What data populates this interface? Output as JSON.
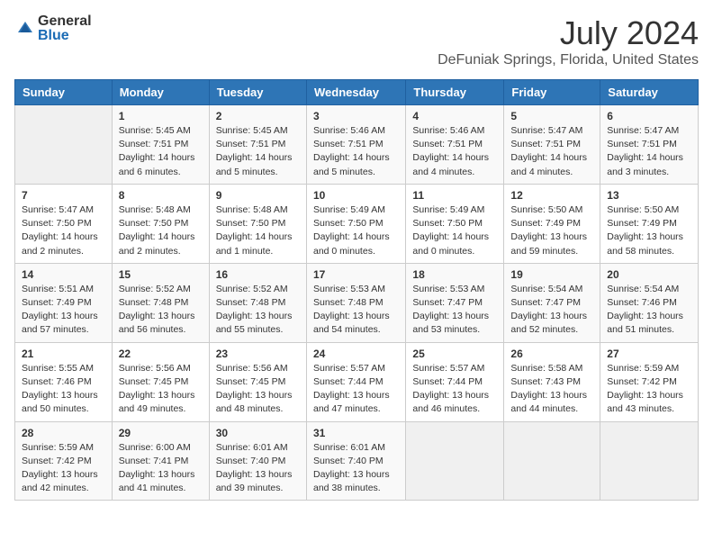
{
  "header": {
    "logo_general": "General",
    "logo_blue": "Blue",
    "main_title": "July 2024",
    "subtitle": "DeFuniak Springs, Florida, United States"
  },
  "days_of_week": [
    "Sunday",
    "Monday",
    "Tuesday",
    "Wednesday",
    "Thursday",
    "Friday",
    "Saturday"
  ],
  "weeks": [
    [
      {
        "day": "",
        "info": ""
      },
      {
        "day": "1",
        "info": "Sunrise: 5:45 AM\nSunset: 7:51 PM\nDaylight: 14 hours\nand 6 minutes."
      },
      {
        "day": "2",
        "info": "Sunrise: 5:45 AM\nSunset: 7:51 PM\nDaylight: 14 hours\nand 5 minutes."
      },
      {
        "day": "3",
        "info": "Sunrise: 5:46 AM\nSunset: 7:51 PM\nDaylight: 14 hours\nand 5 minutes."
      },
      {
        "day": "4",
        "info": "Sunrise: 5:46 AM\nSunset: 7:51 PM\nDaylight: 14 hours\nand 4 minutes."
      },
      {
        "day": "5",
        "info": "Sunrise: 5:47 AM\nSunset: 7:51 PM\nDaylight: 14 hours\nand 4 minutes."
      },
      {
        "day": "6",
        "info": "Sunrise: 5:47 AM\nSunset: 7:51 PM\nDaylight: 14 hours\nand 3 minutes."
      }
    ],
    [
      {
        "day": "7",
        "info": "Sunrise: 5:47 AM\nSunset: 7:50 PM\nDaylight: 14 hours\nand 2 minutes."
      },
      {
        "day": "8",
        "info": "Sunrise: 5:48 AM\nSunset: 7:50 PM\nDaylight: 14 hours\nand 2 minutes."
      },
      {
        "day": "9",
        "info": "Sunrise: 5:48 AM\nSunset: 7:50 PM\nDaylight: 14 hours\nand 1 minute."
      },
      {
        "day": "10",
        "info": "Sunrise: 5:49 AM\nSunset: 7:50 PM\nDaylight: 14 hours\nand 0 minutes."
      },
      {
        "day": "11",
        "info": "Sunrise: 5:49 AM\nSunset: 7:50 PM\nDaylight: 14 hours\nand 0 minutes."
      },
      {
        "day": "12",
        "info": "Sunrise: 5:50 AM\nSunset: 7:49 PM\nDaylight: 13 hours\nand 59 minutes."
      },
      {
        "day": "13",
        "info": "Sunrise: 5:50 AM\nSunset: 7:49 PM\nDaylight: 13 hours\nand 58 minutes."
      }
    ],
    [
      {
        "day": "14",
        "info": "Sunrise: 5:51 AM\nSunset: 7:49 PM\nDaylight: 13 hours\nand 57 minutes."
      },
      {
        "day": "15",
        "info": "Sunrise: 5:52 AM\nSunset: 7:48 PM\nDaylight: 13 hours\nand 56 minutes."
      },
      {
        "day": "16",
        "info": "Sunrise: 5:52 AM\nSunset: 7:48 PM\nDaylight: 13 hours\nand 55 minutes."
      },
      {
        "day": "17",
        "info": "Sunrise: 5:53 AM\nSunset: 7:48 PM\nDaylight: 13 hours\nand 54 minutes."
      },
      {
        "day": "18",
        "info": "Sunrise: 5:53 AM\nSunset: 7:47 PM\nDaylight: 13 hours\nand 53 minutes."
      },
      {
        "day": "19",
        "info": "Sunrise: 5:54 AM\nSunset: 7:47 PM\nDaylight: 13 hours\nand 52 minutes."
      },
      {
        "day": "20",
        "info": "Sunrise: 5:54 AM\nSunset: 7:46 PM\nDaylight: 13 hours\nand 51 minutes."
      }
    ],
    [
      {
        "day": "21",
        "info": "Sunrise: 5:55 AM\nSunset: 7:46 PM\nDaylight: 13 hours\nand 50 minutes."
      },
      {
        "day": "22",
        "info": "Sunrise: 5:56 AM\nSunset: 7:45 PM\nDaylight: 13 hours\nand 49 minutes."
      },
      {
        "day": "23",
        "info": "Sunrise: 5:56 AM\nSunset: 7:45 PM\nDaylight: 13 hours\nand 48 minutes."
      },
      {
        "day": "24",
        "info": "Sunrise: 5:57 AM\nSunset: 7:44 PM\nDaylight: 13 hours\nand 47 minutes."
      },
      {
        "day": "25",
        "info": "Sunrise: 5:57 AM\nSunset: 7:44 PM\nDaylight: 13 hours\nand 46 minutes."
      },
      {
        "day": "26",
        "info": "Sunrise: 5:58 AM\nSunset: 7:43 PM\nDaylight: 13 hours\nand 44 minutes."
      },
      {
        "day": "27",
        "info": "Sunrise: 5:59 AM\nSunset: 7:42 PM\nDaylight: 13 hours\nand 43 minutes."
      }
    ],
    [
      {
        "day": "28",
        "info": "Sunrise: 5:59 AM\nSunset: 7:42 PM\nDaylight: 13 hours\nand 42 minutes."
      },
      {
        "day": "29",
        "info": "Sunrise: 6:00 AM\nSunset: 7:41 PM\nDaylight: 13 hours\nand 41 minutes."
      },
      {
        "day": "30",
        "info": "Sunrise: 6:01 AM\nSunset: 7:40 PM\nDaylight: 13 hours\nand 39 minutes."
      },
      {
        "day": "31",
        "info": "Sunrise: 6:01 AM\nSunset: 7:40 PM\nDaylight: 13 hours\nand 38 minutes."
      },
      {
        "day": "",
        "info": ""
      },
      {
        "day": "",
        "info": ""
      },
      {
        "day": "",
        "info": ""
      }
    ]
  ]
}
